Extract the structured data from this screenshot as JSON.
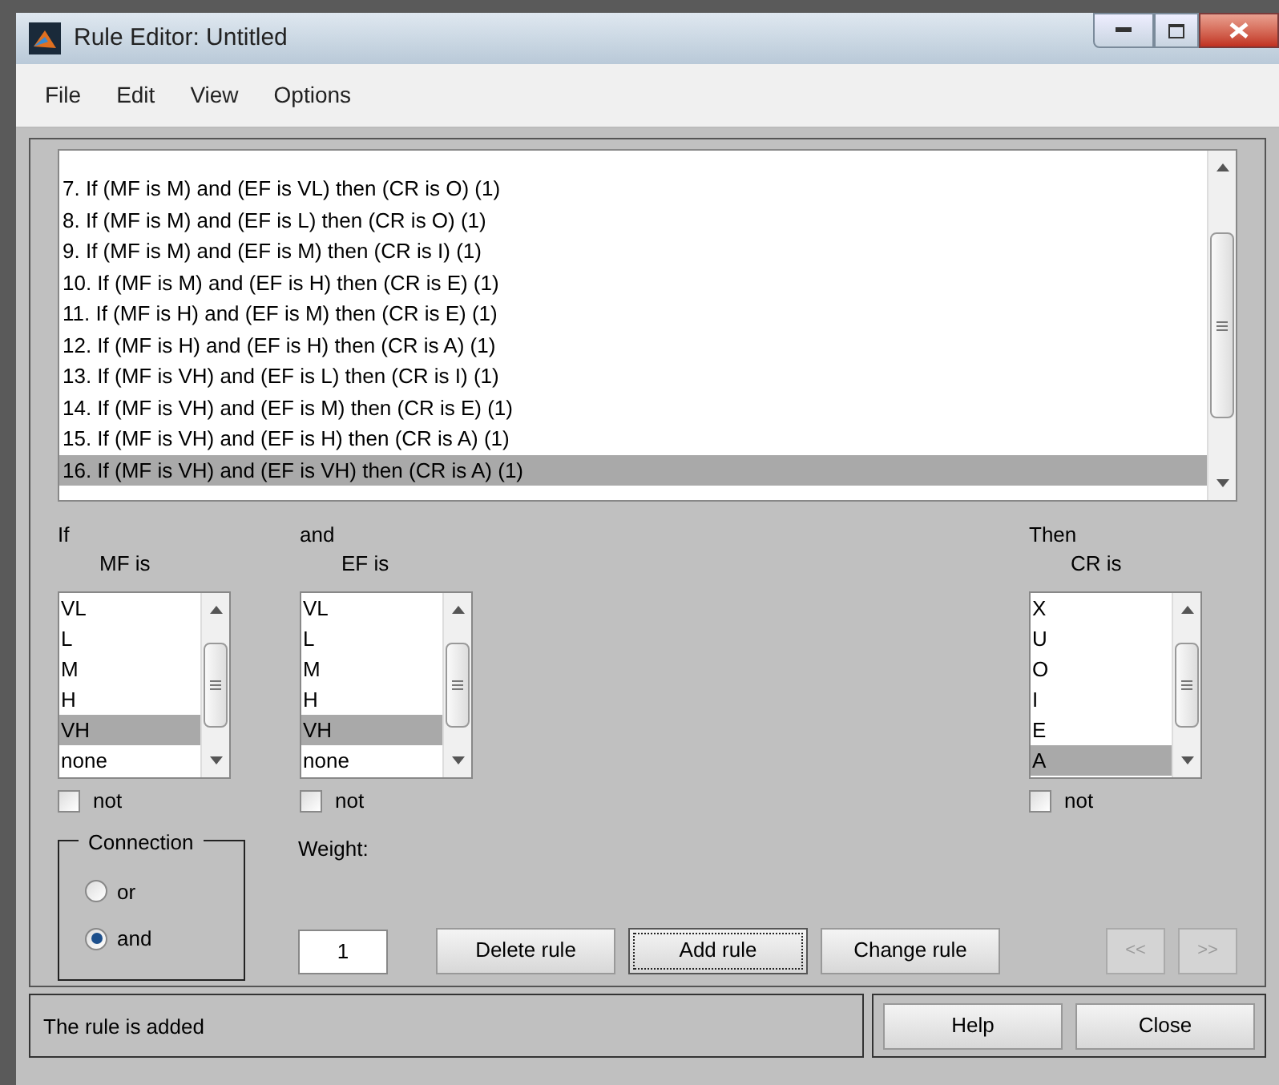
{
  "window": {
    "title": "Rule Editor: Untitled"
  },
  "menu": [
    "File",
    "Edit",
    "View",
    "Options"
  ],
  "rules": [
    {
      "text": "7. If (MF is M) and (EF is VL) then (CR is O) (1)",
      "selected": false
    },
    {
      "text": "8. If (MF is M) and (EF is L) then (CR is O) (1)",
      "selected": false
    },
    {
      "text": "9. If (MF is M) and (EF is M) then (CR is I) (1)",
      "selected": false
    },
    {
      "text": "10. If (MF is M) and (EF is H) then (CR is E) (1)",
      "selected": false
    },
    {
      "text": "11. If (MF is H) and (EF is M) then (CR is E) (1)",
      "selected": false
    },
    {
      "text": "12. If (MF is H) and (EF is H) then (CR is A) (1)",
      "selected": false
    },
    {
      "text": "13. If (MF is VH) and (EF is L) then (CR is I) (1)",
      "selected": false
    },
    {
      "text": "14. If (MF is VH) and (EF is M) then (CR is E) (1)",
      "selected": false
    },
    {
      "text": "15. If (MF is VH) and (EF is H) then (CR is A) (1)",
      "selected": false
    },
    {
      "text": "16. If (MF is VH) and (EF is VH) then (CR is A) (1)",
      "selected": true
    }
  ],
  "variables": [
    {
      "prefix": "If",
      "label": "MF is",
      "items": [
        {
          "text": "VL",
          "selected": false
        },
        {
          "text": "L",
          "selected": false
        },
        {
          "text": "M",
          "selected": false
        },
        {
          "text": "H",
          "selected": false
        },
        {
          "text": "VH",
          "selected": true
        },
        {
          "text": "none",
          "selected": false
        }
      ],
      "not": {
        "label": "not",
        "checked": false
      }
    },
    {
      "prefix": "and",
      "label": "EF is",
      "items": [
        {
          "text": "VL",
          "selected": false
        },
        {
          "text": "L",
          "selected": false
        },
        {
          "text": "M",
          "selected": false
        },
        {
          "text": "H",
          "selected": false
        },
        {
          "text": "VH",
          "selected": true
        },
        {
          "text": "none",
          "selected": false
        }
      ],
      "not": {
        "label": "not",
        "checked": false
      }
    },
    {
      "prefix": "Then",
      "label": "CR is",
      "items": [
        {
          "text": "X",
          "selected": false
        },
        {
          "text": "U",
          "selected": false
        },
        {
          "text": "O",
          "selected": false
        },
        {
          "text": "I",
          "selected": false
        },
        {
          "text": "E",
          "selected": false
        },
        {
          "text": "A",
          "selected": true
        }
      ],
      "not": {
        "label": "not",
        "checked": false
      }
    }
  ],
  "connection": {
    "title": "Connection",
    "options": [
      {
        "label": "or",
        "selected": false
      },
      {
        "label": "and",
        "selected": true
      }
    ]
  },
  "weight": {
    "label": "Weight:",
    "value": "1"
  },
  "rule_buttons": [
    {
      "label": "Delete rule",
      "focused": false
    },
    {
      "label": "Add rule",
      "focused": true
    },
    {
      "label": "Change rule",
      "focused": false
    }
  ],
  "nav_buttons": [
    {
      "label": "<<",
      "disabled": true
    },
    {
      "label": ">>",
      "disabled": true
    }
  ],
  "status": "The rule is added",
  "footer_buttons": [
    "Help",
    "Close"
  ]
}
